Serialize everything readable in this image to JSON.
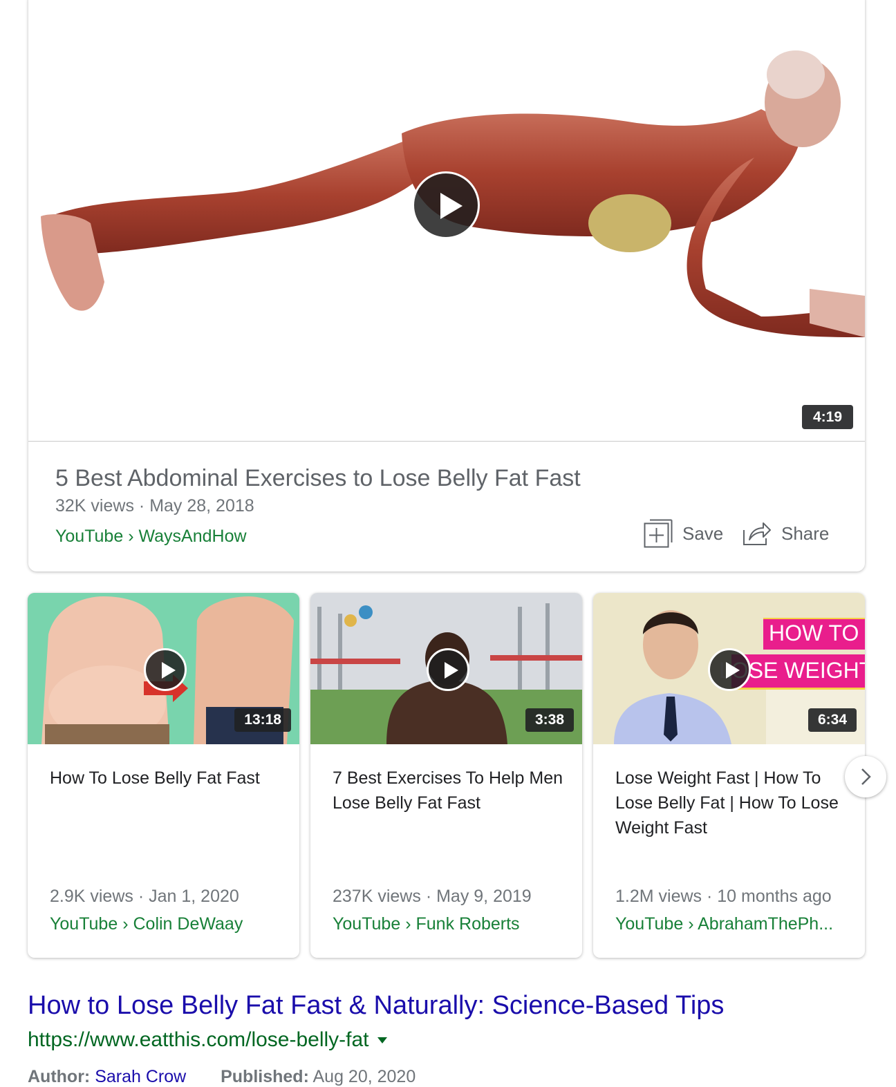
{
  "featured": {
    "duration": "4:19",
    "title": "5 Best Abdominal Exercises to Lose Belly Fat Fast",
    "views": "32K views",
    "date": "May 28, 2018",
    "source": "YouTube",
    "channel": "WaysAndHow",
    "save_label": "Save",
    "share_label": "Share",
    "icons": [
      "play-icon",
      "save-icon",
      "share-icon"
    ]
  },
  "carousel": [
    {
      "duration": "13:18",
      "title": "How To Lose Belly Fat Fast",
      "views": "2.9K views",
      "date": "Jan 1, 2020",
      "source": "YouTube",
      "channel": "Colin DeWaay"
    },
    {
      "duration": "3:38",
      "title": "7 Best Exercises To Help Men Lose Belly Fat Fast",
      "views": "237K views",
      "date": "May 9, 2019",
      "source": "YouTube",
      "channel": "Funk Roberts"
    },
    {
      "duration": "6:34",
      "title": "Lose Weight Fast | How To Lose Belly Fat | How To Lose Weight Fast",
      "views": "1.2M views",
      "date": "10 months ago",
      "source": "YouTube",
      "channel": "AbrahamThePh...",
      "thumb_text": [
        "HOW TO",
        "LOSE WEIGHT"
      ]
    }
  ],
  "result": {
    "title": "How to Lose Belly Fat Fast & Naturally: Science-Based Tips",
    "url": "https://www.eatthis.com/lose-belly-fat",
    "author_label": "Author:",
    "author": "Sarah Crow",
    "published_label": "Published:",
    "published": "Aug 20, 2020"
  },
  "colors": {
    "link_blue": "#1a0dab",
    "source_green": "#188038",
    "url_green": "#006621",
    "meta_gray": "#70757a",
    "accent_pink": "#e91e8c"
  }
}
